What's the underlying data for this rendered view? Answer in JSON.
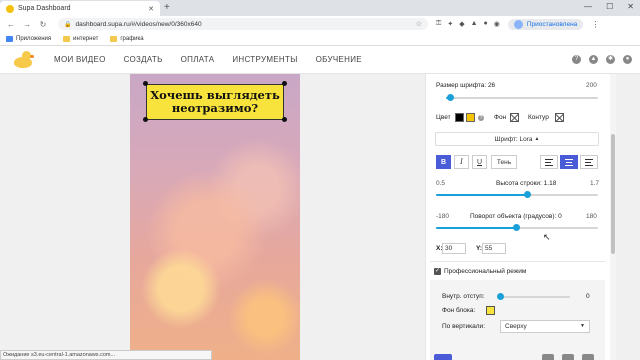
{
  "browser": {
    "tab_title": "Supa Dashboard",
    "url": "dashboard.supa.ru/#/videos/new/0/360x640",
    "paused_label": "Приостановлена",
    "bookmarks": [
      "Приложения",
      "интернет",
      "графика"
    ],
    "status_text": "Ожидание s3.eu-central-1.amazonaws.com..."
  },
  "app": {
    "nav": [
      "МОИ ВИДЕО",
      "СОЗДАТЬ",
      "ОПЛАТА",
      "ИНСТРУМЕНТЫ",
      "ОБУЧЕНИЕ"
    ]
  },
  "canvas": {
    "text_line1": "Хочешь выглядеть",
    "text_line2": "неотразимо?",
    "text_bg_color": "#f7e33b"
  },
  "panel": {
    "font_size_label": "Размер шрифта: 26",
    "font_size_max": "200",
    "color_label": "Цвет",
    "bg_label": "Фон",
    "outline_label": "Контур",
    "font_button": "Шрифт: Lora",
    "bold": "B",
    "italic": "I",
    "underline": "U",
    "shadow": "Тень",
    "line_height_min": "0.5",
    "line_height_label": "Высота строки: 1.18",
    "line_height_max": "1.7",
    "rotation_min": "-180",
    "rotation_label": "Поворот объекта (градусов): 0",
    "rotation_max": "180",
    "x_label": "X:",
    "x_value": "30",
    "y_label": "Y:",
    "y_value": "55",
    "pro_mode_label": "Профессиональный режим",
    "padding_label": "Внутр. отступ:",
    "padding_value": "0",
    "block_bg_label": "Фон блока:",
    "vertical_label": "По вертикали:",
    "vertical_value": "Сверху",
    "accent_color": "#1aa0d8",
    "active_button_color": "#4a5bd8"
  }
}
